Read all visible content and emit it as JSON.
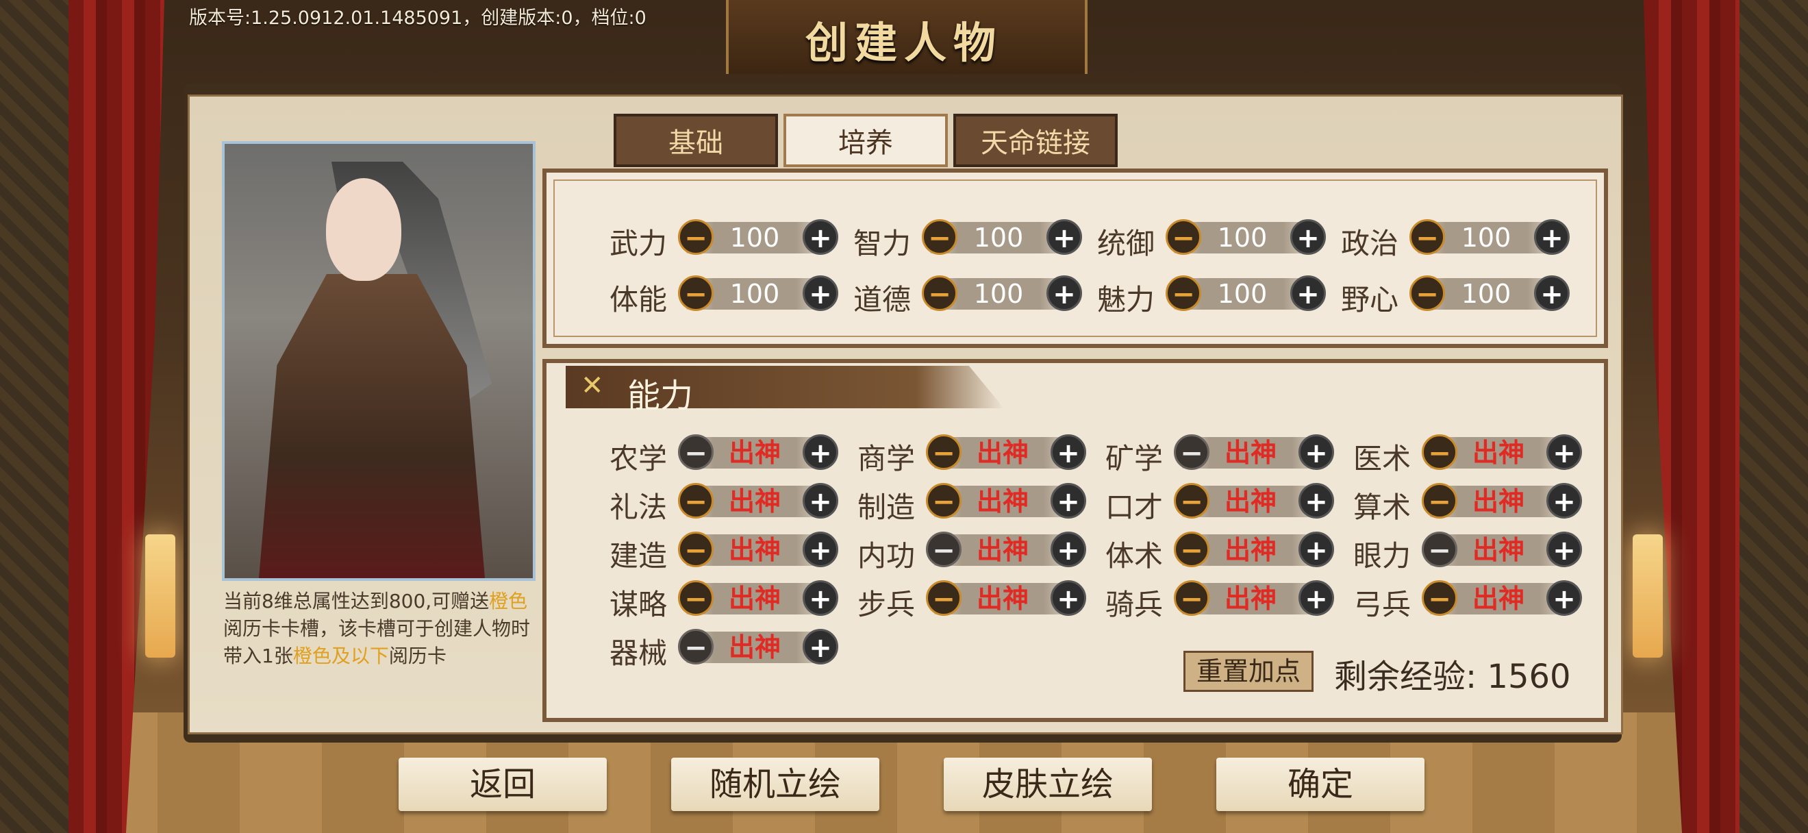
{
  "header": {
    "version_text": "版本号:1.25.0912.01.1485091，创建版本:0，档位:0",
    "title": "创建人物"
  },
  "tabs": [
    {
      "label": "基础",
      "active": false
    },
    {
      "label": "培养",
      "active": true
    },
    {
      "label": "天命链接",
      "active": false
    }
  ],
  "attributes": [
    {
      "label": "武力",
      "value": "100"
    },
    {
      "label": "智力",
      "value": "100"
    },
    {
      "label": "统御",
      "value": "100"
    },
    {
      "label": "政治",
      "value": "100"
    },
    {
      "label": "体能",
      "value": "100"
    },
    {
      "label": "道德",
      "value": "100"
    },
    {
      "label": "魅力",
      "value": "100"
    },
    {
      "label": "野心",
      "value": "100"
    }
  ],
  "ability_section": {
    "close_icon": "cross-swords-icon",
    "title": "能力"
  },
  "abilities": [
    {
      "label": "农学",
      "value": "出神",
      "minus_active": false
    },
    {
      "label": "商学",
      "value": "出神",
      "minus_active": true
    },
    {
      "label": "矿学",
      "value": "出神",
      "minus_active": false
    },
    {
      "label": "医术",
      "value": "出神",
      "minus_active": true
    },
    {
      "label": "礼法",
      "value": "出神",
      "minus_active": true
    },
    {
      "label": "制造",
      "value": "出神",
      "minus_active": true
    },
    {
      "label": "口才",
      "value": "出神",
      "minus_active": true
    },
    {
      "label": "算术",
      "value": "出神",
      "minus_active": true
    },
    {
      "label": "建造",
      "value": "出神",
      "minus_active": true
    },
    {
      "label": "内功",
      "value": "出神",
      "minus_active": false
    },
    {
      "label": "体术",
      "value": "出神",
      "minus_active": true
    },
    {
      "label": "眼力",
      "value": "出神",
      "minus_active": false
    },
    {
      "label": "谋略",
      "value": "出神",
      "minus_active": true
    },
    {
      "label": "步兵",
      "value": "出神",
      "minus_active": true
    },
    {
      "label": "骑兵",
      "value": "出神",
      "minus_active": true
    },
    {
      "label": "弓兵",
      "value": "出神",
      "minus_active": true
    },
    {
      "label": "器械",
      "value": "出神",
      "minus_active": false
    }
  ],
  "bonus_info": {
    "part1": "当前8维总属性达到800,可赠送",
    "highlight1": "橙色",
    "part2": "阅历卡卡槽，该卡槽可于创建人物时带入1张",
    "highlight2": "橙色及以下",
    "part3": "阅历卡"
  },
  "reset_button": "重置加点",
  "remaining_exp": "剩余经验:  1560",
  "bottom_buttons": {
    "back": "返回",
    "random_portrait": "随机立绘",
    "skin_portrait": "皮肤立绘",
    "confirm": "确定"
  },
  "colors": {
    "tier_text": "#e02a24",
    "highlight": "#e0a020",
    "panel_bg": "#e7dcc5",
    "curtain": "#9c221c"
  }
}
